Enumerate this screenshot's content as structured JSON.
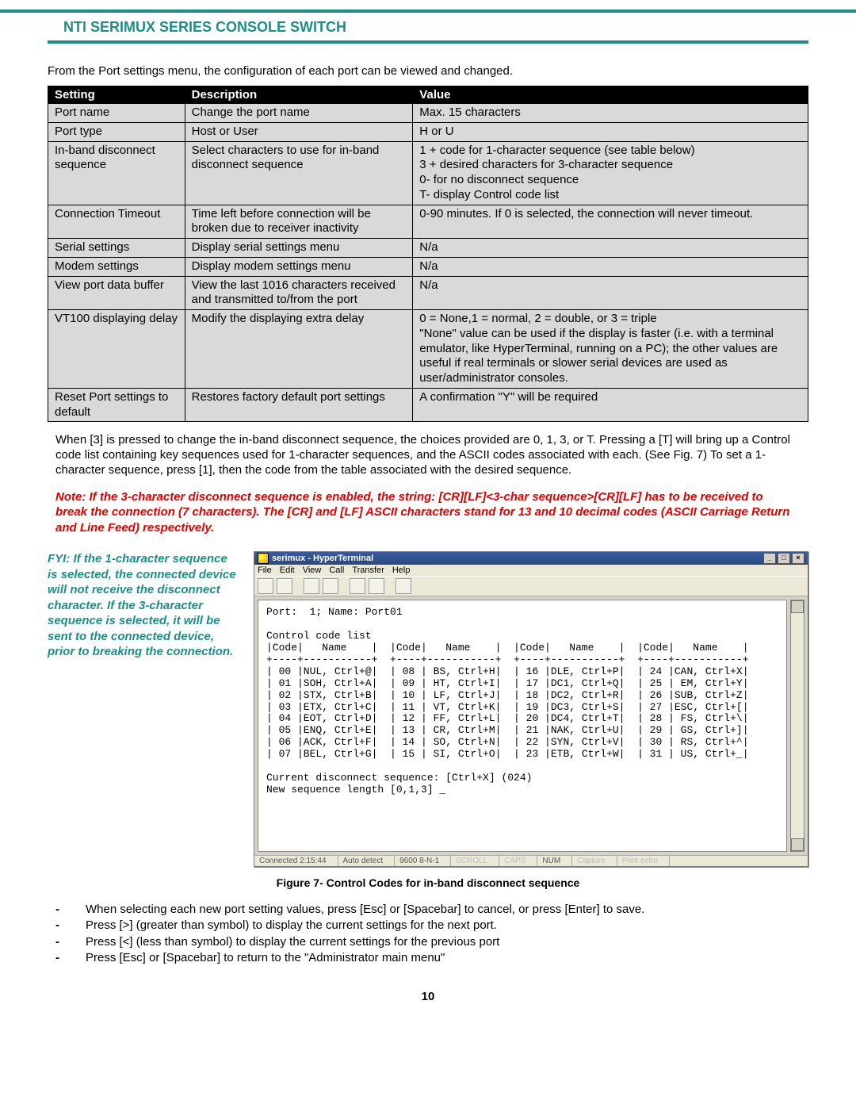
{
  "doc_title": "NTI SERIMUX SERIES CONSOLE SWITCH",
  "intro": "From the Port settings menu, the configuration of each port can be viewed and changed.",
  "table_headers": {
    "setting": "Setting",
    "description": "Description",
    "value": "Value"
  },
  "rows": [
    {
      "s": "Port name",
      "d": "Change the port name",
      "v": "Max. 15 characters"
    },
    {
      "s": "Port type",
      "d": "Host or User",
      "v": "H   or  U"
    },
    {
      "s": "In-band disconnect sequence",
      "d": "Select characters to use for in-band disconnect sequence",
      "v": "1 + code for 1-character sequence (see table below)\n3 + desired characters for 3-character sequence\n0-   for no disconnect sequence\nT-  display Control code list"
    },
    {
      "s": "Connection Timeout",
      "d": "Time left before connection will be broken due to receiver inactivity",
      "v": "0-90 minutes.    If 0 is selected,  the connection will never timeout."
    },
    {
      "s": "Serial settings",
      "d": "Display serial settings menu",
      "v": "N/a"
    },
    {
      "s": "Modem settings",
      "d": "Display modem settings menu",
      "v": "N/a"
    },
    {
      "s": "View port data buffer",
      "d": "View the last 1016 characters received and transmitted to/from the port",
      "v": "N/a"
    },
    {
      "s": "VT100 displaying delay",
      "d": "Modify the displaying extra delay",
      "v": "0 = None,1 = normal, 2 = double, or 3 = triple\n\"None\" value can be used if the display is faster (i.e. with a terminal emulator, like HyperTerminal, running on a PC); the other values are useful if real terminals or slower serial devices are used as user/administrator consoles."
    },
    {
      "s": "Reset Port settings to default",
      "d": "Restores factory default port settings",
      "v": "A confirmation \"Y\"  will be required"
    }
  ],
  "para2": "When [3] is pressed to change the in-band disconnect sequence,  the choices provided are 0, 1, 3, or T.   Pressing a [T] will bring up a Control code list containing key sequences used for 1-character sequences,  and the ASCII codes associated with each.  (See Fig. 7)   To set a 1-character sequence, press [1], then the code from the table associated with the desired sequence.",
  "note": "Note: If the 3-character disconnect sequence is enabled, the string: [CR][LF]<3-char sequence>[CR][LF] has to be received to break the connection (7 characters).    The [CR] and [LF] ASCII characters stand for 13 and 10 decimal codes (ASCII Carriage Return and Line Feed) respectively.",
  "fyi": "FYI: If the 1-character sequence is selected, the connected device will not receive the disconnect character. If the 3-character sequence is selected, it will be sent to the connected device, prior to breaking the connection.",
  "ht": {
    "title": "serimux - HyperTerminal",
    "menu": [
      "File",
      "Edit",
      "View",
      "Call",
      "Transfer",
      "Help"
    ],
    "body": "Port:  1; Name: Port01\n\nControl code list\n|Code|   Name    |  |Code|   Name    |  |Code|   Name    |  |Code|   Name    |\n+----+-----------+  +----+-----------+  +----+-----------+  +----+-----------+\n| 00 |NUL, Ctrl+@|  | 08 | BS, Ctrl+H|  | 16 |DLE, Ctrl+P|  | 24 |CAN, Ctrl+X|\n| 01 |SOH, Ctrl+A|  | 09 | HT, Ctrl+I|  | 17 |DC1, Ctrl+Q|  | 25 | EM, Ctrl+Y|\n| 02 |STX, Ctrl+B|  | 10 | LF, Ctrl+J|  | 18 |DC2, Ctrl+R|  | 26 |SUB, Ctrl+Z|\n| 03 |ETX, Ctrl+C|  | 11 | VT, Ctrl+K|  | 19 |DC3, Ctrl+S|  | 27 |ESC, Ctrl+[|\n| 04 |EOT, Ctrl+D|  | 12 | FF, Ctrl+L|  | 20 |DC4, Ctrl+T|  | 28 | FS, Ctrl+\\|\n| 05 |ENQ, Ctrl+E|  | 13 | CR, Ctrl+M|  | 21 |NAK, Ctrl+U|  | 29 | GS, Ctrl+]|\n| 06 |ACK, Ctrl+F|  | 14 | SO, Ctrl+N|  | 22 |SYN, Ctrl+V|  | 30 | RS, Ctrl+^|\n| 07 |BEL, Ctrl+G|  | 15 | SI, Ctrl+O|  | 23 |ETB, Ctrl+W|  | 31 | US, Ctrl+_|\n\nCurrent disconnect sequence: [Ctrl+X] (024)\nNew sequence length [0,1,3] _",
    "status": [
      "Connected 2:15:44",
      "Auto detect",
      "9600 8-N-1",
      "SCROLL",
      "CAPS",
      "NUM",
      "Capture",
      "Print echo"
    ]
  },
  "figure_caption": "Figure 7- Control Codes for in-band disconnect sequence",
  "bullets": [
    "When selecting each new port setting values,  press [Esc] or [Spacebar] to cancel,   or press [Enter] to save.",
    "Press [>] (greater than symbol) to display the current settings for the next port.",
    "Press [<] (less than symbol) to display the current settings for the previous port",
    "Press [Esc] or [Spacebar] to return to the \"Administrator main menu\""
  ],
  "page_number": "10"
}
